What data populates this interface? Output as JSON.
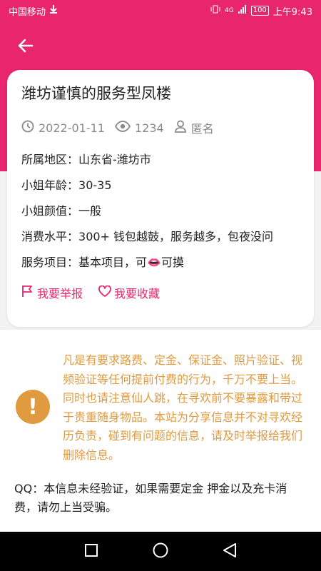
{
  "status_bar": {
    "carrier": "中国移动",
    "signal": "4G",
    "battery": "100",
    "time": "上午9:43"
  },
  "post": {
    "title": "潍坊谨慎的服务型凤楼",
    "date": "2022-01-11",
    "views": "1234",
    "author": "匿名",
    "fields": [
      {
        "label": "所属地区：",
        "value": "山东省-潍坊市"
      },
      {
        "label": "小姐年龄：",
        "value": "30-35"
      },
      {
        "label": "小姐颜值：",
        "value": "一般"
      },
      {
        "label": "消费水平：",
        "value": "300+ 钱包越鼓，服务越多，包夜没问"
      },
      {
        "label": "服务项目：",
        "value": "基本项目，可👄可摸"
      }
    ],
    "actions": {
      "report": "我要举报",
      "favorite": "我要收藏"
    }
  },
  "notice": {
    "warning_text": "凡是有要求路费、定金、保证金、照片验证、视频验证等任何提前付费的行为，千万不要上当。同时也请注意仙人跳，在寻欢前不要暴露和带过于贵重随身物品。本站为分享信息并不对寻欢经历负责，碰到有问题的信息，请及时举报给我们删除信息。",
    "qq_text": "QQ：本信息未经验证，如果需要定金 押金以及充卡消费，请勿上当受骗。",
    "icon_glyph": "!"
  },
  "colors": {
    "brand": "#e8256d",
    "warning": "#e09a3f"
  },
  "icons": [
    "arrow-left-icon",
    "clock-icon",
    "eye-icon",
    "user-icon",
    "flag-icon",
    "heart-icon",
    "exclamation-icon",
    "square-icon",
    "circle-icon",
    "triangle-back-icon"
  ]
}
